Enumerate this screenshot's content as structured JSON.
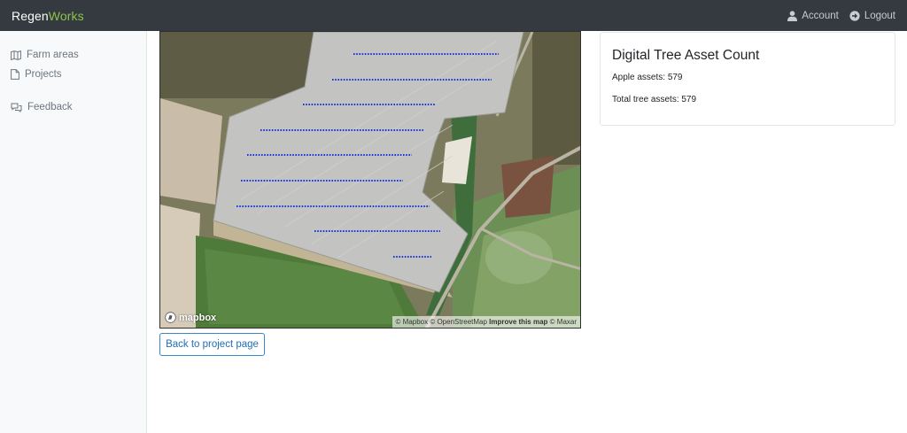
{
  "navbar": {
    "brand_part1": "Regen",
    "brand_part2": "Works",
    "account_label": "Account",
    "logout_label": "Logout"
  },
  "sidebar": {
    "items": [
      {
        "label": "Farm areas",
        "icon": "map-icon"
      },
      {
        "label": "Projects",
        "icon": "file-icon"
      },
      {
        "label": "Feedback",
        "icon": "comments-icon"
      }
    ]
  },
  "map": {
    "logo_text": "mapbox",
    "attribution": {
      "mapbox": "© Mapbox",
      "osm": "© OpenStreetMap",
      "improve": "Improve this map",
      "maxar": "© Maxar"
    },
    "tree_point_color": "#1a35e0"
  },
  "back_button_label": "Back to project page",
  "asset_card": {
    "title": "Digital Tree Asset Count",
    "apple_assets": "Apple assets: 579",
    "total_assets": "Total tree assets: 579"
  },
  "colors": {
    "navbar_bg": "#343a40",
    "brand_accent": "#8bc34a",
    "button_accent": "#1f6fb5"
  }
}
